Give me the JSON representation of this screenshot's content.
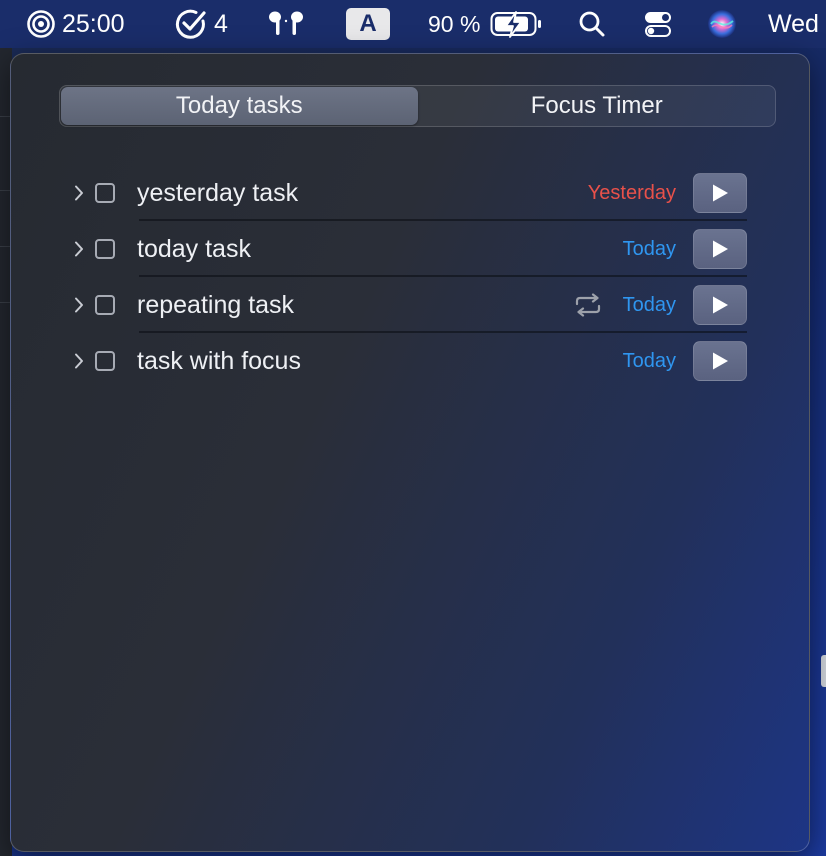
{
  "menubar": {
    "focus_timer": "25:00",
    "task_count": "4",
    "input_source": "A",
    "battery_percent": "90 %",
    "clock": "Wed",
    "icons": [
      "focus-target-icon",
      "checkmark-circle-icon",
      "airpods-icon",
      "keyboard-input-icon",
      "battery-charging-icon",
      "search-icon",
      "control-center-icon",
      "siri-icon"
    ]
  },
  "tabs": [
    {
      "label": "Today tasks",
      "active": true
    },
    {
      "label": "Focus Timer",
      "active": false
    }
  ],
  "tasks": [
    {
      "title": "yesterday task",
      "due": "Yesterday",
      "overdue": true,
      "repeating": false
    },
    {
      "title": "today task",
      "due": "Today",
      "overdue": false,
      "repeating": false
    },
    {
      "title": "repeating task",
      "due": "Today",
      "overdue": false,
      "repeating": true
    },
    {
      "title": "task with focus",
      "due": "Today",
      "overdue": false,
      "repeating": false
    }
  ],
  "colors": {
    "overdue": "#e8514a",
    "today": "#2f96f0",
    "menubar": "#1a2d6a"
  }
}
